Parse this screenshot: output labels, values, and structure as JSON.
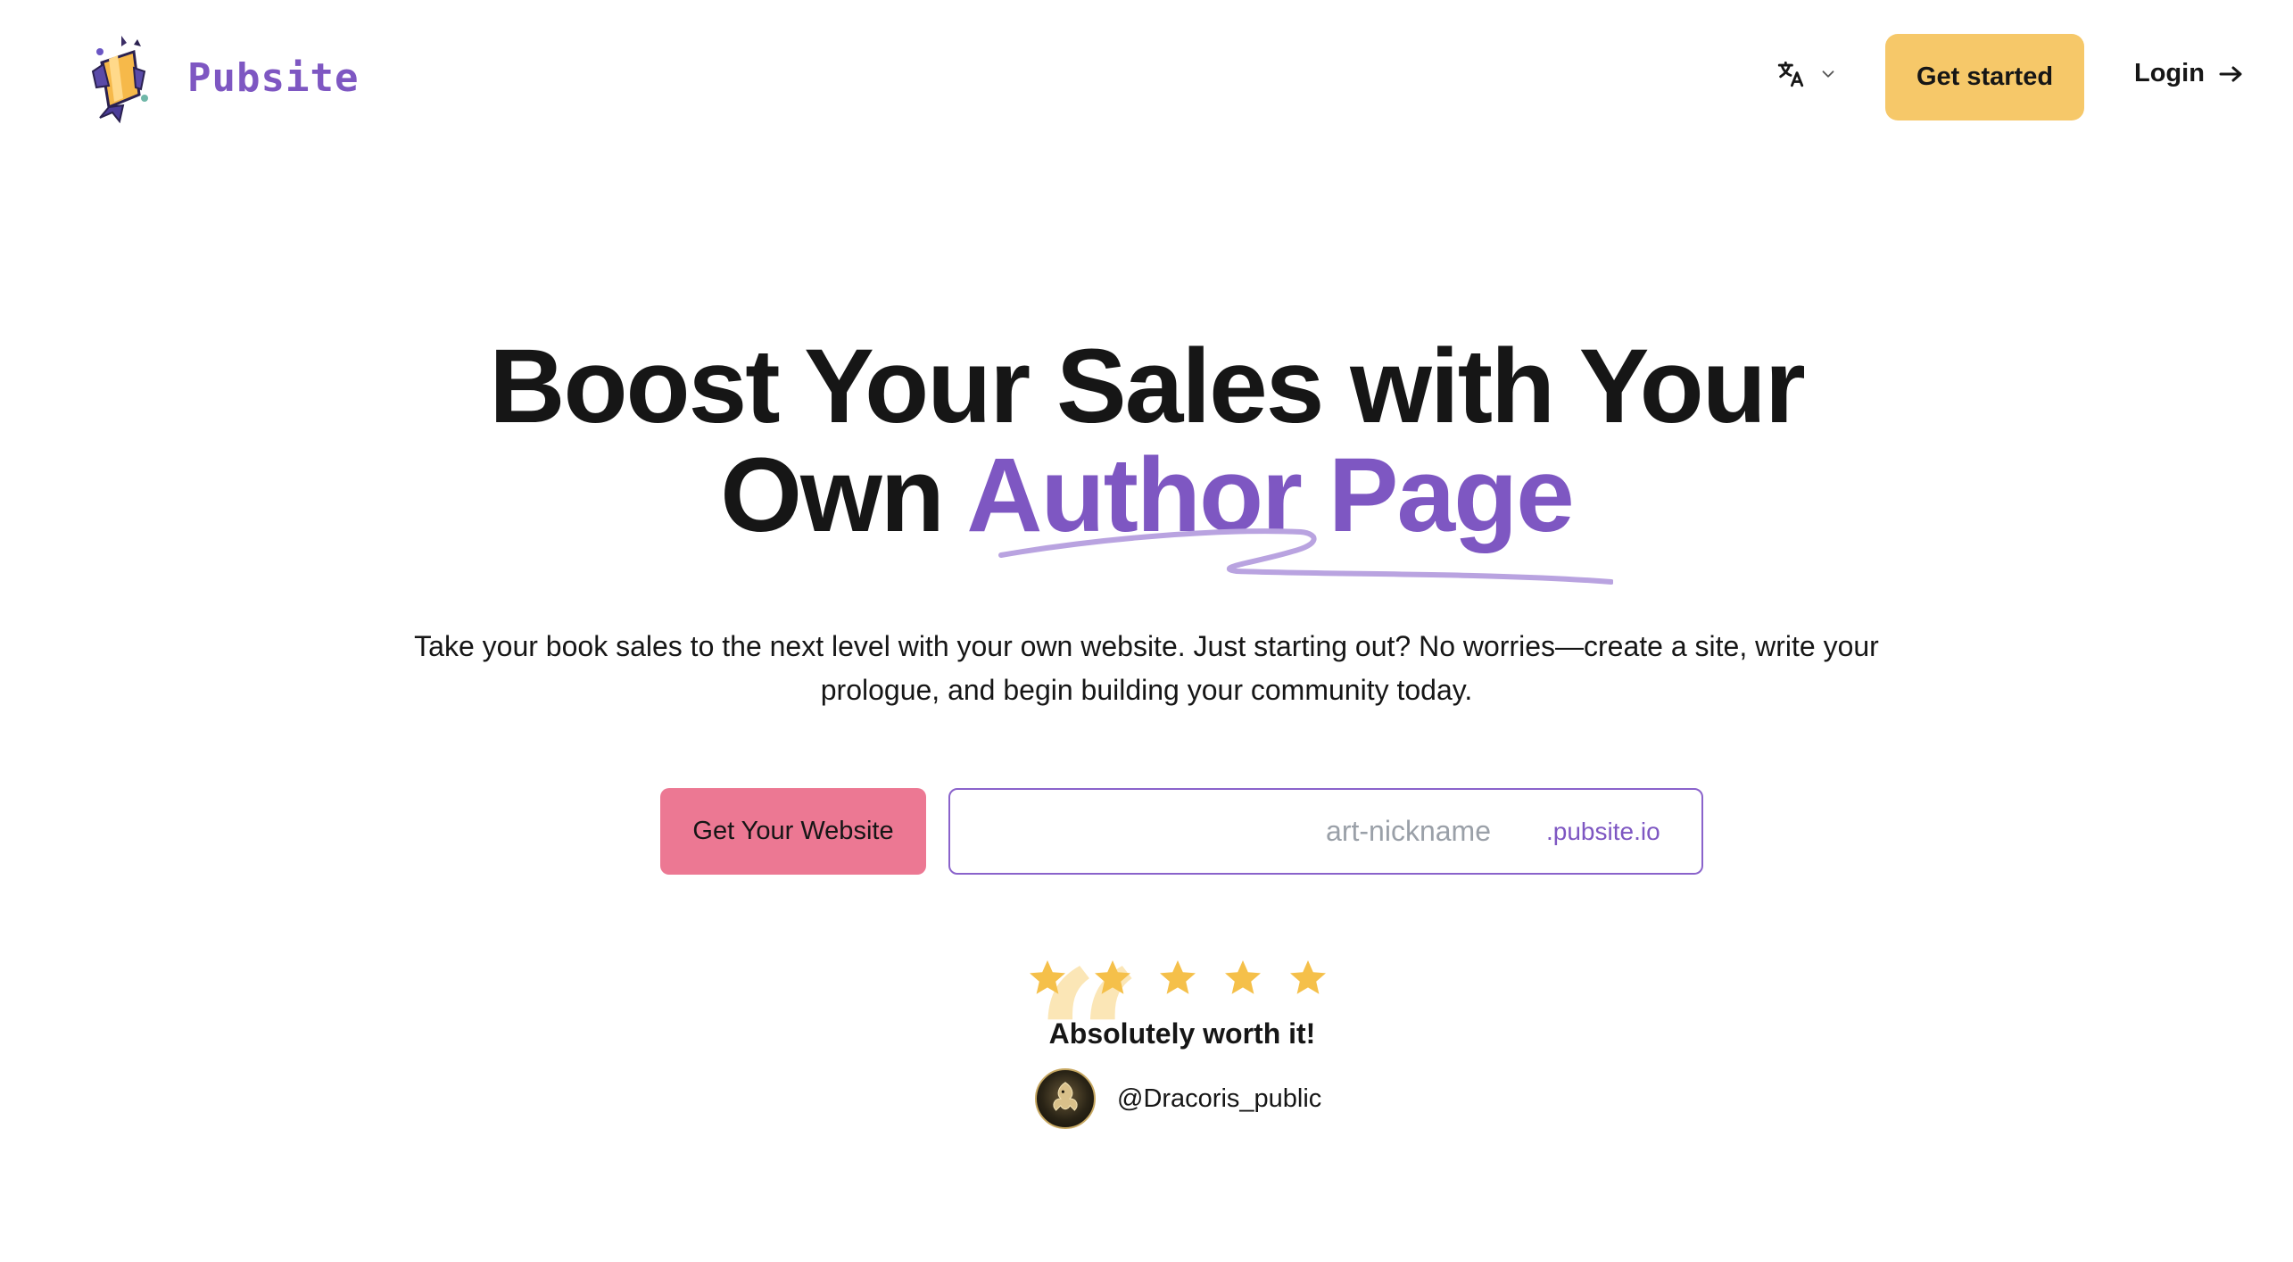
{
  "header": {
    "brand": "Pubsite",
    "get_started_label": "Get started",
    "login_label": "Login"
  },
  "hero": {
    "title_line1": "Boost Your Sales with Your",
    "title_line2_plain": "Own ",
    "title_line2_accent": "Author Page",
    "subtitle": "Take your book sales to the next level with your own website. Just starting out? No worries—create a site, write your prologue, and begin building your community today."
  },
  "cta": {
    "button_label": "Get Your Website",
    "nickname_placeholder": "art-nickname",
    "nickname_value": "",
    "domain_suffix": ".pubsite.io"
  },
  "testimonial": {
    "rating": 5,
    "max_rating": 5,
    "text": "Absolutely worth it!",
    "handle": "@Dracoris_public"
  },
  "colors": {
    "brand_purple": "#7e57c2",
    "get_started_bg": "#f6c869",
    "cta_pink": "#ec7893",
    "star_gold": "#f5c04a"
  },
  "icons": {
    "logo": "rocket-pencil-logo",
    "language": "translate-icon",
    "language_dropdown": "chevron-down-icon",
    "login": "arrow-right-icon",
    "star": "star-icon",
    "quote": "quote-icon"
  }
}
